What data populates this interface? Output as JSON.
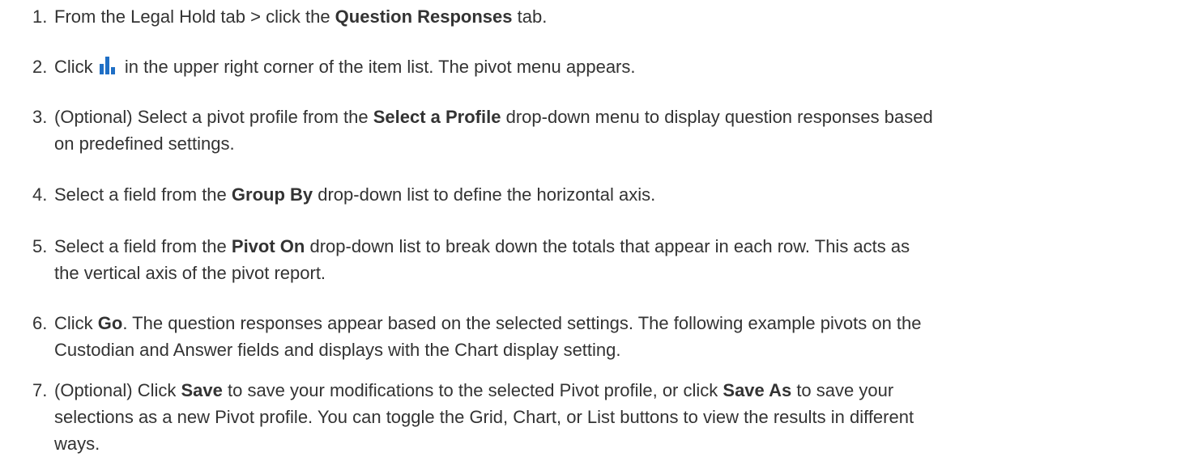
{
  "steps": [
    {
      "num": "1.",
      "a": "From the Legal Hold tab > click the ",
      "b1": "Question Responses",
      "c": " tab."
    },
    {
      "num": "2.",
      "a": "Click ",
      "icon": "pivot-bar-chart-icon",
      "c": " in the upper right corner of the item list. The pivot menu appears."
    },
    {
      "num": "3.",
      "a": "(Optional) Select a pivot profile from the ",
      "b1": "Select a Profile",
      "c1": " drop-down menu to display question responses based",
      "c2": "on predefined settings."
    },
    {
      "num": "4.",
      "a": "Select a field from the ",
      "b1": "Group By",
      "c": " drop-down list to define the horizontal axis."
    },
    {
      "num": "5.",
      "a": "Select a field from the ",
      "b1": "Pivot On",
      "c1": " drop-down list to break down the totals that appear in each row. This acts as",
      "c2": "the vertical axis of the pivot report."
    },
    {
      "num": "6.",
      "a": "Click ",
      "b1": "Go",
      "c1": ". The question responses appear based on the selected settings. The following example pivots on the",
      "c2": "Custodian and Answer fields and displays with the Chart display setting."
    },
    {
      "num": "7.",
      "a": "(Optional) Click ",
      "b1": "Save",
      "m": " to save your modifications to the selected Pivot profile, or click ",
      "b2": "Save As",
      "c1": " to save your",
      "c2": "selections as a new Pivot profile. You can toggle the Grid, Chart, or List buttons to view the results in different",
      "c3": "ways."
    }
  ],
  "colors": {
    "text": "#333333",
    "icon": "#1f6fc5"
  }
}
